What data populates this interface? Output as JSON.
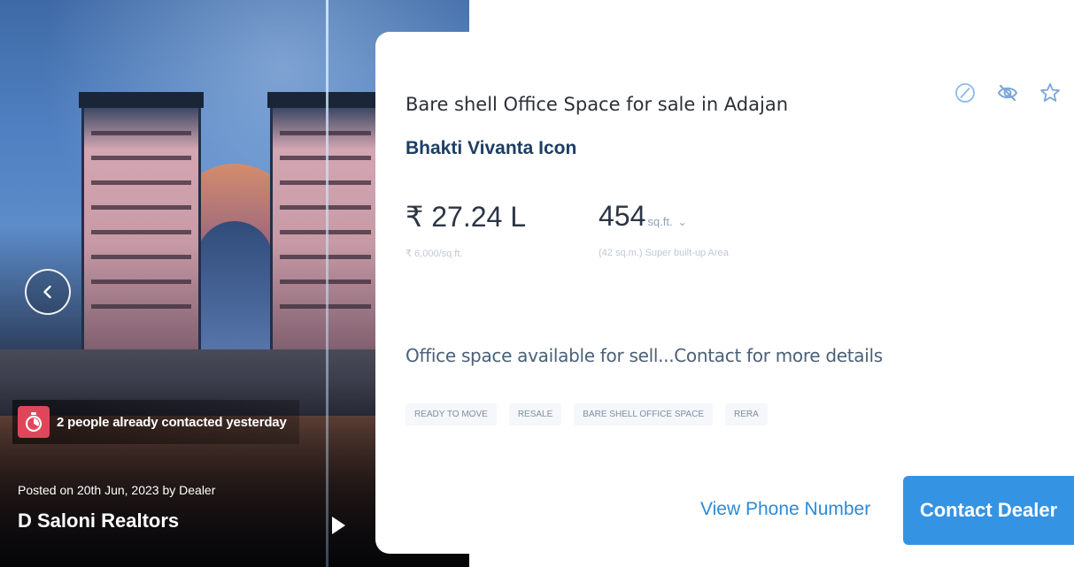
{
  "listing": {
    "title": "Bare shell Office Space for sale in Adajan",
    "project": "Bhakti Vivanta Icon",
    "price": "₹ 27.24 L",
    "price_per_sqft": "₹ 6,000/sq.ft.",
    "area_value": "454",
    "area_unit": "sq.ft.",
    "area_sub": "(42 sq.m.) Super built-up Area",
    "description": "Office space available for sell...Contact for more details",
    "tags": [
      "READY TO MOVE",
      "RESALE",
      "BARE SHELL OFFICE SPACE",
      "RERA"
    ]
  },
  "photo": {
    "contacted_text": "2 people already contacted yesterday",
    "posted_text": "Posted on 20th Jun, 2023 by Dealer",
    "dealer_name": "D Saloni Realtors"
  },
  "actions": {
    "view_phone": "View Phone Number",
    "contact": "Contact Dealer"
  },
  "icons": {
    "report": "report-icon",
    "hide": "hide-icon",
    "shortlist": "star-icon",
    "prev": "chevron-left-icon",
    "next": "play-right-icon",
    "badge": "timer-icon"
  },
  "colors": {
    "accent": "#3593e3",
    "link": "#2d8ad8",
    "project": "#1e3e63",
    "badge": "#e0465a"
  }
}
